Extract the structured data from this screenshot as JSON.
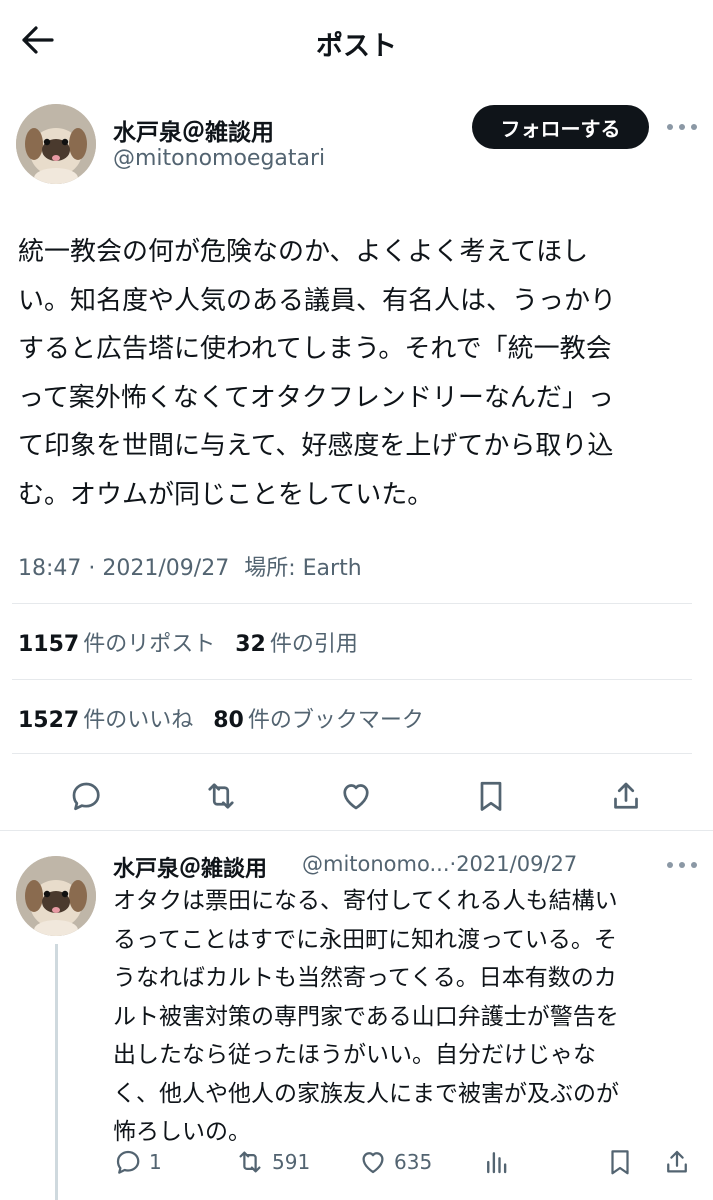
{
  "header": {
    "title": "ポスト"
  },
  "post": {
    "author_name": "水戸泉＠雑談用",
    "author_handle": "@mitonomoegatari",
    "follow_label": "フォローする",
    "text": "統一教会の何が危険なのか、よくよく考えてほし\nい。知名度や人気のある議員、有名人は、うっかり\nすると広告塔に使われてしまう。それで「統一教会\nって案外怖くなくてオタクフレンドリーなんだ」っ\nて印象を世間に与えて、好感度を上げてから取り込\nむ。オウムが同じことをしていた。",
    "time": "18:47",
    "date": "2021/09/27",
    "location_label": "場所:",
    "location": "Earth",
    "reposts_count": "1157",
    "reposts_label": "件のリポスト",
    "quotes_count": "32",
    "quotes_label": "件の引用",
    "likes_count": "1527",
    "likes_label": "件のいいね",
    "bookmarks_count": "80",
    "bookmarks_label": "件のブックマーク"
  },
  "reply": {
    "author_name": "水戸泉＠雑談用",
    "author_handle": "@mitonomo...",
    "separator": "·",
    "date": "2021/09/27",
    "text": "オタクは票田になる、寄付してくれる人も結構い\nるってことはすでに永田町に知れ渡っている。そ\nうなればカルトも当然寄ってくる。日本有数のカ\nルト被害対策の専門家である山口弁護士が警告を\n出したなら従ったほうがいい。自分だけじゃな\nく、他人や他人の家族友人にまで被害が及ぶのが\n怖ろしいの。",
    "reply_count": "1",
    "repost_count": "591",
    "like_count": "635"
  },
  "colors": {
    "text": "#0f1419",
    "secondary": "#536471",
    "divider": "#e6e9ec"
  }
}
